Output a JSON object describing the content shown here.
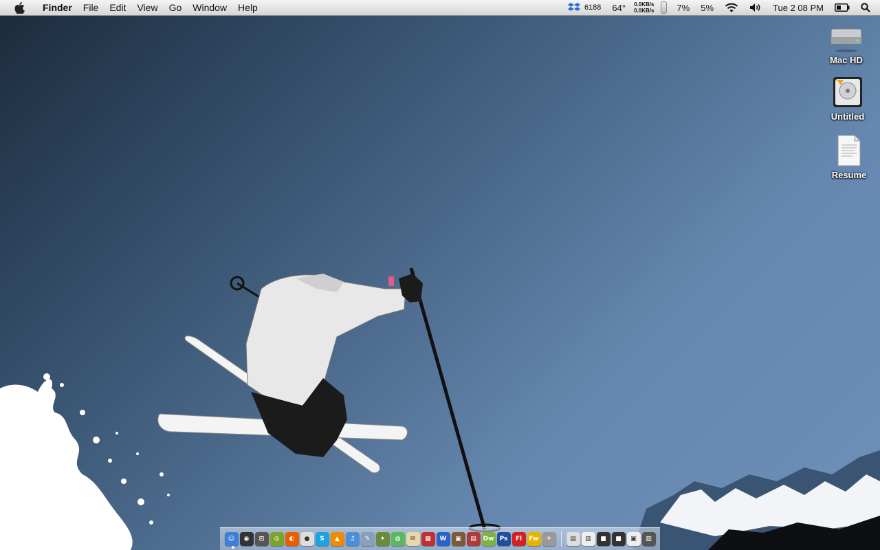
{
  "menubar": {
    "app_name": "Finder",
    "menus": [
      "File",
      "Edit",
      "View",
      "Go",
      "Window",
      "Help"
    ],
    "status": {
      "dropbox_count": "6188",
      "temperature": "64°",
      "net_up": "0.0KB/s",
      "net_down": "0.0KB/s",
      "cpu": "7%",
      "mem": "5%",
      "clock": "Tue 2 08 PM"
    }
  },
  "desktop": {
    "icons": [
      {
        "label": "Mac HD",
        "icon": "hard-drive-icon"
      },
      {
        "label": "Untitled",
        "icon": "disk-icon"
      },
      {
        "label": "Resume",
        "icon": "document-icon"
      }
    ]
  },
  "dock": {
    "apps": [
      {
        "name": "finder-icon",
        "color": "#3d7fd6",
        "glyph": "☺"
      },
      {
        "name": "dashboard-icon",
        "color": "#333333",
        "glyph": "◉"
      },
      {
        "name": "screenshot-icon",
        "color": "#555555",
        "glyph": "⊡"
      },
      {
        "name": "adium-icon",
        "color": "#7aa52a",
        "glyph": "◎"
      },
      {
        "name": "firefox-icon",
        "color": "#e66000",
        "glyph": "◐"
      },
      {
        "name": "alien-icon",
        "color": "#dddddd",
        "glyph": "●"
      },
      {
        "name": "skype-icon",
        "color": "#1aa3e0",
        "glyph": "S"
      },
      {
        "name": "vlc-icon",
        "color": "#f08a00",
        "glyph": "▲"
      },
      {
        "name": "itunes-icon",
        "color": "#4a8fd8",
        "glyph": "♫"
      },
      {
        "name": "preview-icon",
        "color": "#8aa0b8",
        "glyph": "✎"
      },
      {
        "name": "game-icon",
        "color": "#6b8a3a",
        "glyph": "✦"
      },
      {
        "name": "chrome-icon",
        "color": "#5cb85c",
        "glyph": "◍"
      },
      {
        "name": "mail-icon",
        "color": "#e8d8a8",
        "glyph": "✉"
      },
      {
        "name": "calendar-icon",
        "color": "#c03030",
        "glyph": "▦"
      },
      {
        "name": "word-icon",
        "color": "#2a62c8",
        "glyph": "W"
      },
      {
        "name": "photo-icon",
        "color": "#7a5a3a",
        "glyph": "▣"
      },
      {
        "name": "photo-booth-icon",
        "color": "#b03a3a",
        "glyph": "▤"
      },
      {
        "name": "dreamweaver-icon",
        "color": "#7cb342",
        "glyph": "Dw"
      },
      {
        "name": "photoshop-icon",
        "color": "#1e4e9c",
        "glyph": "Ps"
      },
      {
        "name": "flash-icon",
        "color": "#d42020",
        "glyph": "Fl"
      },
      {
        "name": "fireworks-icon",
        "color": "#e8b400",
        "glyph": "Fw"
      },
      {
        "name": "plane-icon",
        "color": "#999999",
        "glyph": "✈"
      }
    ],
    "stacks": [
      {
        "name": "documents-stack-icon",
        "color": "#dddddd",
        "glyph": "▤"
      },
      {
        "name": "text-stack-icon",
        "color": "#eeeeee",
        "glyph": "▥"
      },
      {
        "name": "folder-stack-icon",
        "color": "#333333",
        "glyph": "■"
      },
      {
        "name": "downloads-stack-icon",
        "color": "#333333",
        "glyph": "■"
      },
      {
        "name": "applications-stack-icon",
        "color": "#eeeeee",
        "glyph": "▣"
      },
      {
        "name": "trash-icon",
        "color": "#555555",
        "glyph": "▥"
      }
    ]
  }
}
